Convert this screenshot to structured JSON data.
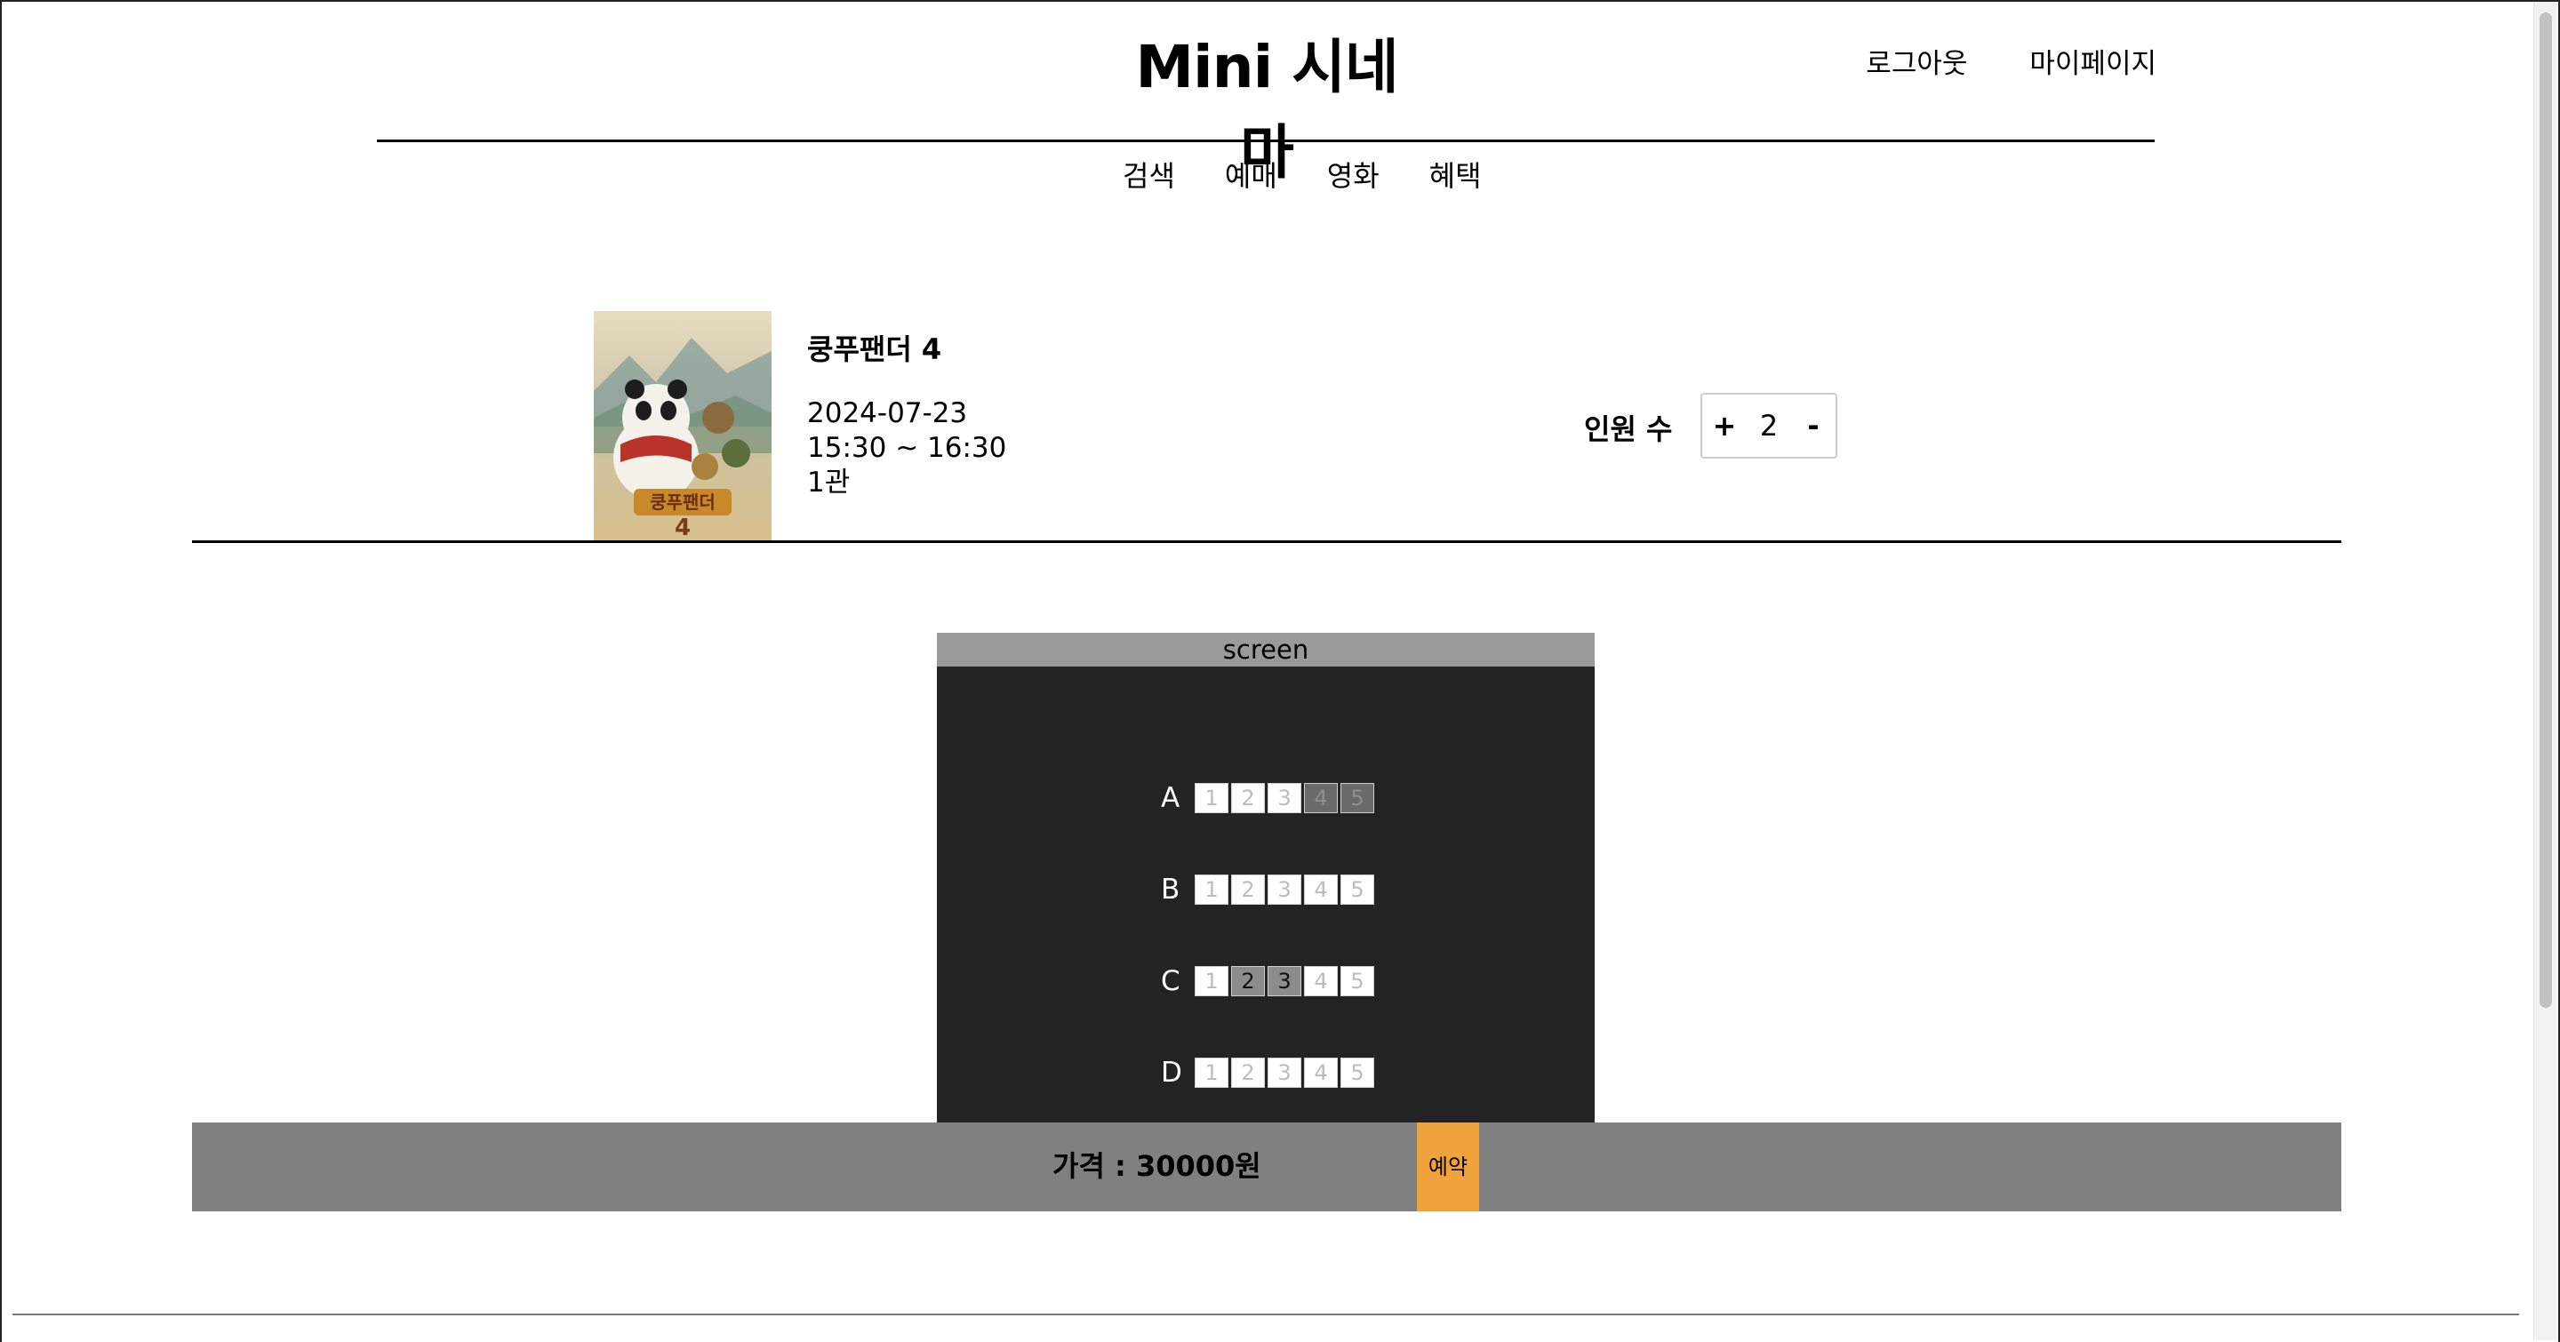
{
  "header": {
    "title": "Mini 시네마",
    "logout_label": "로그아웃",
    "mypage_label": "마이페이지"
  },
  "nav": {
    "items": [
      {
        "label": "검색"
      },
      {
        "label": "예매"
      },
      {
        "label": "영화"
      },
      {
        "label": "혜택"
      }
    ]
  },
  "movie": {
    "title": "쿵푸팬더 4",
    "date": "2024-07-23",
    "time": "15:30 ~ 16:30",
    "hall": "1관"
  },
  "people": {
    "label": "인원 수",
    "plus": "+",
    "count": "2",
    "minus": "-"
  },
  "theater": {
    "screen_label": "screen",
    "rows": [
      {
        "label": "A",
        "seats": [
          {
            "num": "1",
            "state": "available"
          },
          {
            "num": "2",
            "state": "available"
          },
          {
            "num": "3",
            "state": "available"
          },
          {
            "num": "4",
            "state": "taken"
          },
          {
            "num": "5",
            "state": "taken"
          }
        ]
      },
      {
        "label": "B",
        "seats": [
          {
            "num": "1",
            "state": "available"
          },
          {
            "num": "2",
            "state": "available"
          },
          {
            "num": "3",
            "state": "available"
          },
          {
            "num": "4",
            "state": "available"
          },
          {
            "num": "5",
            "state": "available"
          }
        ]
      },
      {
        "label": "C",
        "seats": [
          {
            "num": "1",
            "state": "available"
          },
          {
            "num": "2",
            "state": "selected"
          },
          {
            "num": "3",
            "state": "selected"
          },
          {
            "num": "4",
            "state": "available"
          },
          {
            "num": "5",
            "state": "available"
          }
        ]
      },
      {
        "label": "D",
        "seats": [
          {
            "num": "1",
            "state": "available"
          },
          {
            "num": "2",
            "state": "available"
          },
          {
            "num": "3",
            "state": "available"
          },
          {
            "num": "4",
            "state": "available"
          },
          {
            "num": "5",
            "state": "available"
          }
        ]
      }
    ]
  },
  "footer": {
    "price": "가격 : 30000원",
    "reserve_label": "예약"
  },
  "colors": {
    "hall_bg": "#232323",
    "screen_bar": "#9a9a9a",
    "price_bar": "#808080",
    "reserve_button": "#f0a33c"
  }
}
